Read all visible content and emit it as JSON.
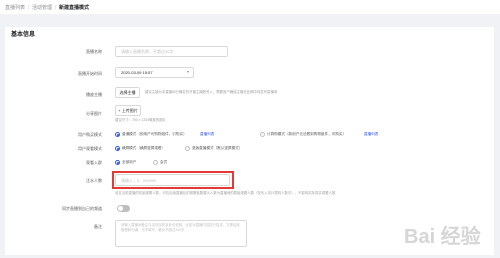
{
  "breadcrumb": {
    "item1": "直播列表",
    "sep": "/",
    "item2": "活动管理",
    "current": "新建直播模式"
  },
  "section": {
    "title": "基本信息"
  },
  "form": {
    "name": {
      "label": "直播名称",
      "placeholder": "请输入直播名称，不超过30字"
    },
    "start_time": {
      "label": "直播开始时间",
      "value": "2020-03-09 15:57"
    },
    "cover": {
      "label": "播放主播",
      "button": "选择主播",
      "hint": "建议主播为本直播间已确定的开播主播账号入，需要用户确保主播在此期中线发布直播间"
    },
    "share_image": {
      "label": "分享图片",
      "button": "+ 上传图片",
      "hint": "建议尺寸：750 × 1334像素的图片"
    },
    "order_mode": {
      "label": "用户购买模式",
      "options": [
        "普通模式（即用户可购物组件、引购买）",
        "直播列表",
        "计算购模式（新用户无法看到购物组件，可购买）",
        "直播列表"
      ],
      "selected": 0
    },
    "watch_mode": {
      "label": "用户观看模式",
      "options": [
        "横屏模式（横屏竖屏观看）",
        "竖版直播模式（默认竖屏模式）"
      ],
      "selected": 0
    },
    "entry": {
      "label": "观看入群",
      "options": [
        "全部用户",
        "会员"
      ],
      "selected": 0
    },
    "announce": {
      "label": "注水人数",
      "placeholder": "请输入，0 - 999999",
      "hint": "设定当前直播的初始观看人数，可在后续直播后的观看者数展示人数为直播间的原始观看人数（仅代入将计算到人数中），不影响实际真实观看人数"
    },
    "sync": {
      "label": "同步直播到自己的频道"
    },
    "remark": {
      "label": "备注",
      "placeholder": "请输入直播间备注与活动目的及补充说明，比如对直播内容进行描述，方便后续管理和沟通，可不填写，最长不超过200字"
    }
  },
  "watermark": {
    "text": "Bai 经验"
  },
  "colors": {
    "accent": "#2f54eb",
    "highlight": "#e53935",
    "background": "#f0f2f5"
  }
}
